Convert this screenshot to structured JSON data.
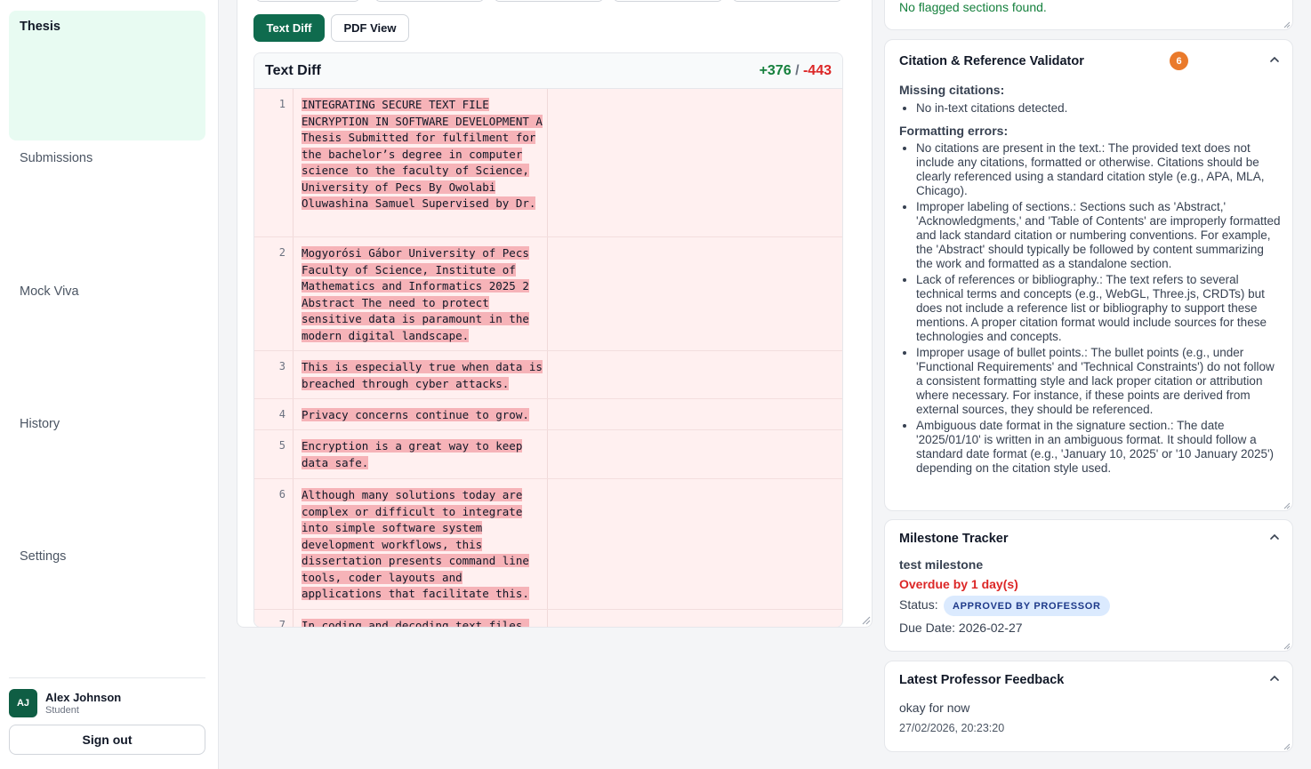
{
  "sidebar": {
    "nav": [
      "Thesis",
      "Submissions",
      "Mock Viva",
      "History",
      "Settings"
    ],
    "user": {
      "initials": "AJ",
      "name": "Alex Johnson",
      "role": "Student"
    },
    "signout_label": "Sign out"
  },
  "viewer": {
    "text_diff_label": "Text Diff",
    "pdf_view_label": "PDF View",
    "diff": {
      "title": "Text Diff",
      "added": "+376",
      "separator": "/",
      "removed": "-443",
      "rows": [
        {
          "num": "1",
          "text": "INTEGRATING SECURE TEXT FILE ENCRYPTION IN SOFTWARE DEVELOPMENT A Thesis Submitted for fulfilment for the bachelor’s degree in computer science to the faculty of Science, University of Pecs By Owolabi Oluwashina Samuel Supervised by Dr."
        },
        {
          "num": "2",
          "text": "Mogyorósi Gábor University of Pecs Faculty of Science, Institute of Mathematics and Informatics 2025 2 Abstract The need to protect sensitive data is paramount in the modern digital landscape."
        },
        {
          "num": "3",
          "text": "This is especially true when data is breached through cyber attacks."
        },
        {
          "num": "4",
          "text": "Privacy concerns continue to grow."
        },
        {
          "num": "5",
          "text": "Encryption is a great way to keep data safe."
        },
        {
          "num": "6",
          "text": "Although many solutions today are complex or difficult to integrate into simple software system development workflows, this dissertation presents command line tools, coder layouts and applications that facilitate this."
        },
        {
          "num": "7",
          "text": "In coding and decoding text files,"
        }
      ]
    }
  },
  "flagged": {
    "message": "No flagged sections found."
  },
  "citation": {
    "title": "Citation & Reference Validator",
    "count": "6",
    "missing_label": "Missing citations:",
    "missing": [
      "No in-text citations detected."
    ],
    "formatting_label": "Formatting errors:",
    "errors": [
      "No citations are present in the text.: The provided text does not include any citations, formatted or otherwise. Citations should be clearly referenced using a standard citation style (e.g., APA, MLA, Chicago).",
      "Improper labeling of sections.: Sections such as 'Abstract,' 'Acknowledgments,' and 'Table of Contents' are improperly formatted and lack standard citation or numbering conventions. For example, the 'Abstract' should typically be followed by content summarizing the work and formatted as a standalone section.",
      "Lack of references or bibliography.: The text refers to several technical terms and concepts (e.g., WebGL, Three.js, CRDTs) but does not include a reference list or bibliography to support these mentions. A proper citation format would include sources for these technologies and concepts.",
      "Improper usage of bullet points.: The bullet points (e.g., under 'Functional Requirements' and 'Technical Constraints') do not follow a consistent formatting style and lack proper citation or attribution where necessary. For instance, if these points are derived from external sources, they should be referenced.",
      "Ambiguous date format in the signature section.: The date '2025/01/10' is written in an ambiguous format. It should follow a standard date format (e.g., 'January 10, 2025' or '10 January 2025') depending on the citation style used."
    ]
  },
  "milestone": {
    "title": "Milestone Tracker",
    "name": "test milestone",
    "overdue": "Overdue by 1 day(s)",
    "status_label": "Status:",
    "status": "APPROVED BY PROFESSOR",
    "due": "Due Date: 2026-02-27"
  },
  "feedback": {
    "title": "Latest Professor Feedback",
    "text": "okay for now",
    "timestamp": "27/02/2026, 20:23:20"
  },
  "colors": {
    "accent": "#0f6b4e",
    "added": "#15803d",
    "removed": "#dc2626",
    "badge": "#ea7a2b"
  },
  "icons": [
    "chevron-up-icon",
    "resize-grip-icon"
  ]
}
